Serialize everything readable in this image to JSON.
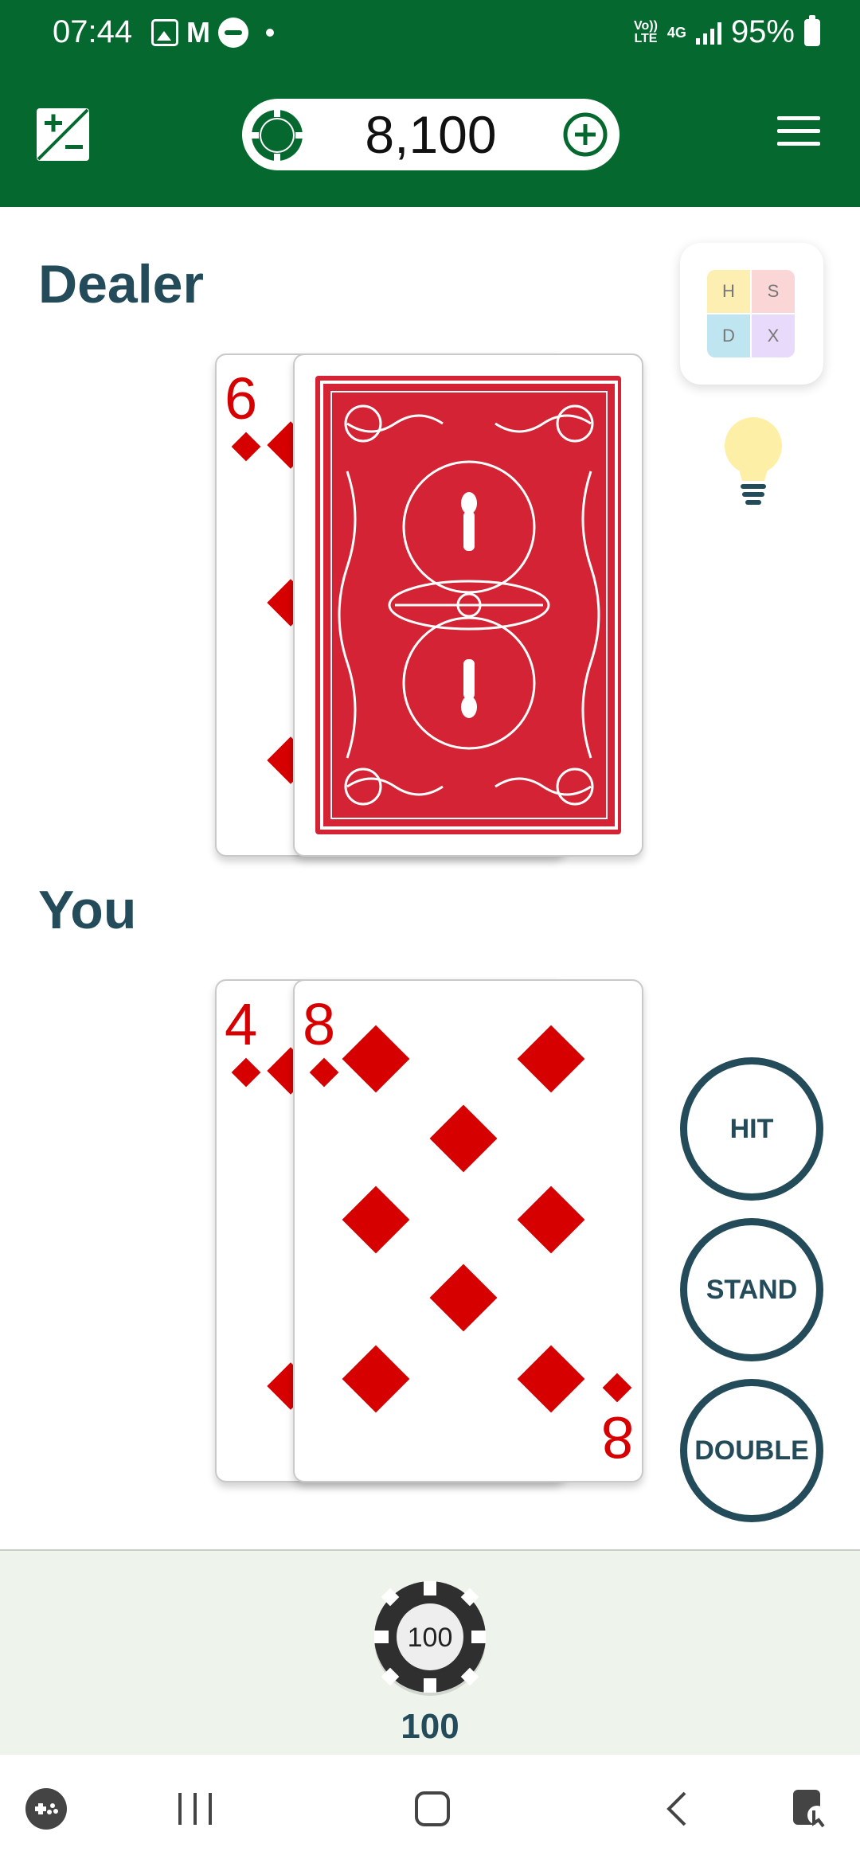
{
  "status_bar": {
    "time": "07:44",
    "mail_glyph": "M",
    "volte": "Vo)) LTE",
    "network": "4G",
    "battery": "95%"
  },
  "app_bar": {
    "coins": "8,100",
    "icons": [
      "plus-minus-icon",
      "poker-chip-icon",
      "add-circle-icon",
      "hamburger-menu-icon"
    ]
  },
  "dealer": {
    "label": "Dealer",
    "cards": [
      {
        "rank": "6",
        "suit": "diamonds",
        "face_up": true
      },
      {
        "face_up": false
      }
    ]
  },
  "player": {
    "label": "You",
    "cards": [
      {
        "rank": "4",
        "suit": "diamonds",
        "face_up": true
      },
      {
        "rank": "8",
        "suit": "diamonds",
        "face_up": true
      }
    ]
  },
  "strategy_chart": {
    "cells": [
      "H",
      "S",
      "D",
      "X"
    ],
    "colors": [
      "#fdeeb2",
      "#fad6d6",
      "#bfe6f0",
      "#e8dafa"
    ]
  },
  "actions": {
    "hit": "HIT",
    "stand": "STAND",
    "double": "DOUBLE"
  },
  "bet": {
    "chip_label": "100",
    "amount": "100"
  },
  "colors": {
    "app_bar": "#05692f",
    "accent_text": "#234b5a",
    "card_red": "#d60000",
    "card_back": "#d32334",
    "bet_area": "#eef4ec"
  }
}
